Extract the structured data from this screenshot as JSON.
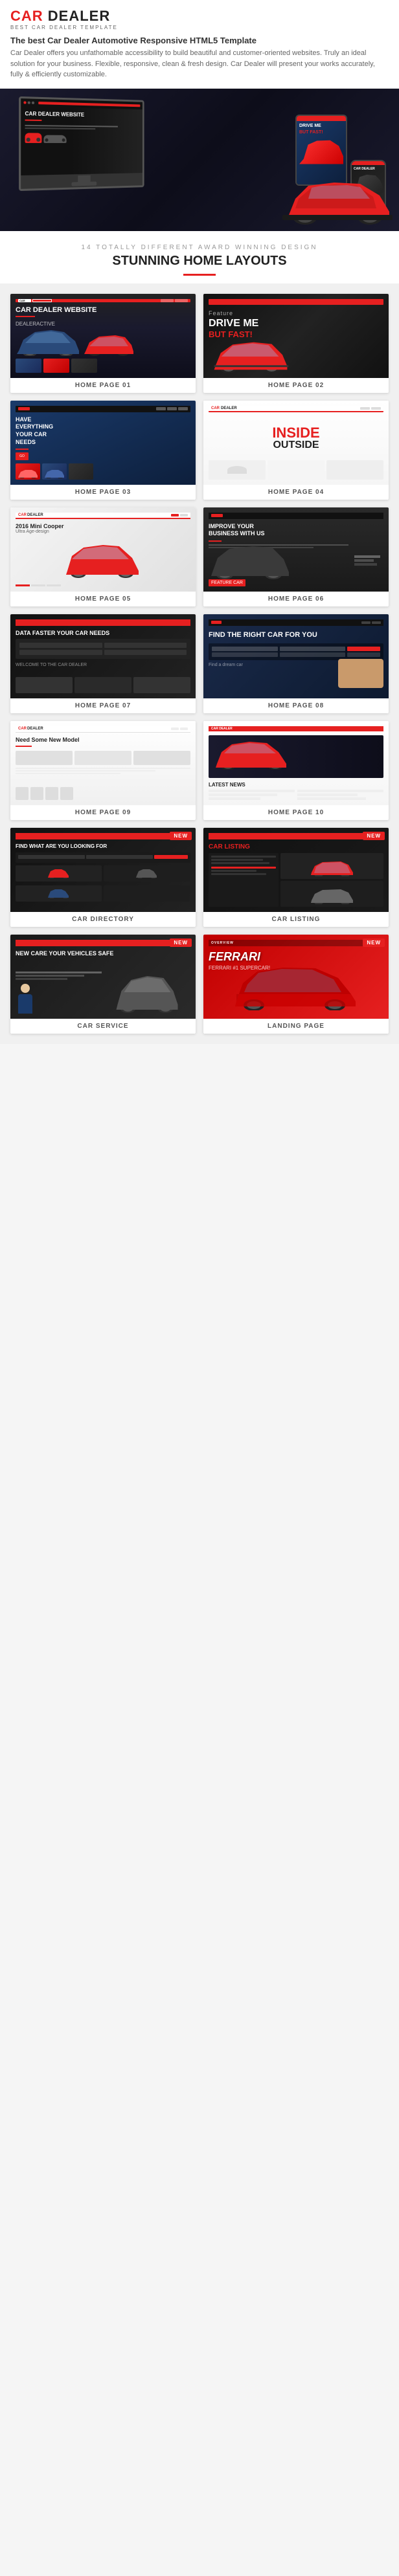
{
  "header": {
    "logo": "CAR DEALER",
    "logo_sub": "BEST CAR DEALER TEMPLATE",
    "tagline": "The best Car Dealer Automotive Responsive HTML5 Template",
    "description": "Car Dealer offers you unfathomable accessibility to build beautiful and customer-oriented websites. Truly an ideal solution for your business. Flexible, responsive, clean & fresh design. Car Dealer will present your works accurately, fully & efficiently customizable."
  },
  "section_title": {
    "subtitle": "14 TOTALLY DIFFERENT AWARD WINNING DESIGN",
    "title": "STUNNING HOME LAYOUTS"
  },
  "thumbnails": [
    {
      "id": "hp01",
      "label": "HOME PAGE 01",
      "sim": "hp01",
      "has_new": false
    },
    {
      "id": "hp02",
      "label": "HOME PAGE 02",
      "sim": "hp02",
      "has_new": false
    },
    {
      "id": "hp03",
      "label": "HOME PAGE 03",
      "sim": "hp03",
      "has_new": false
    },
    {
      "id": "hp04",
      "label": "HOME PAGE 04",
      "sim": "hp04",
      "has_new": false
    },
    {
      "id": "hp05",
      "label": "HOME PAGE 05",
      "sim": "hp05",
      "has_new": false
    },
    {
      "id": "hp06",
      "label": "HOME PAGE 06",
      "sim": "hp06",
      "has_new": false
    },
    {
      "id": "hp07",
      "label": "HOME PAGE 07",
      "sim": "hp07",
      "has_new": false
    },
    {
      "id": "hp08",
      "label": "HOME PAGE 08",
      "sim": "hp08",
      "has_new": false
    },
    {
      "id": "hp09",
      "label": "HOME PAGE 09",
      "sim": "hp09",
      "has_new": false
    },
    {
      "id": "hp10",
      "label": "HOME PAGE 10",
      "sim": "hp10",
      "has_new": false
    },
    {
      "id": "cardir",
      "label": "CAR DIRECTORY",
      "sim": "cardir",
      "has_new": true
    },
    {
      "id": "carlisting",
      "label": "CAR LISTING",
      "sim": "carlisting",
      "has_new": true
    },
    {
      "id": "carservice",
      "label": "CAR SERVICE",
      "sim": "carservice",
      "has_new": false
    },
    {
      "id": "landing",
      "label": "LANDING PAGE",
      "sim": "landing",
      "has_new": true
    }
  ],
  "hp01": {
    "title": "CAR DEALER WEBSITE",
    "subtitle": "DEALERACTIVE"
  },
  "hp02": {
    "line1": "DRIVE ME",
    "line2": "BUT FAST!"
  },
  "hp03": {
    "title": "HAVE EVERYTHING YOUR CAR NEEDS"
  },
  "hp04": {
    "inside": "INSIDE",
    "outside": "OUTSIDE"
  },
  "hp05": {
    "car": "2016 Mini Cooper",
    "sub": "Ultra Age-design"
  },
  "hp06": {
    "title": "IMPROVE YOUR BUSINESS WITH US"
  },
  "hp07": {
    "title": "DATA FASTER YOUR CAR NEEDS"
  },
  "hp08": {
    "title": "FIND THE RIGHT CAR FOR YOU"
  },
  "hp09": {
    "title": "Need Some New Model"
  },
  "hp10": {
    "title": "CAR DEALER",
    "subtitle": "LATEST NEWS"
  },
  "cardir": {
    "new_badge": "NEW",
    "title": "FIND WHAT ARE YOU LOOKING FOR"
  },
  "carlisting": {
    "new_badge": "NEW",
    "title": "CAR LISTING"
  },
  "carservice": {
    "new_badge": "NEW",
    "title": "NEW CARE YOUR VEHICLES SAFE"
  },
  "landing": {
    "new_badge": "NEW",
    "title": "FERRARI",
    "subtitle": "FERRARI #1 SUPERCAR!"
  },
  "colors": {
    "red": "#e62020",
    "dark": "#1a1a2e",
    "bg": "#f0f0f0",
    "white": "#ffffff"
  }
}
